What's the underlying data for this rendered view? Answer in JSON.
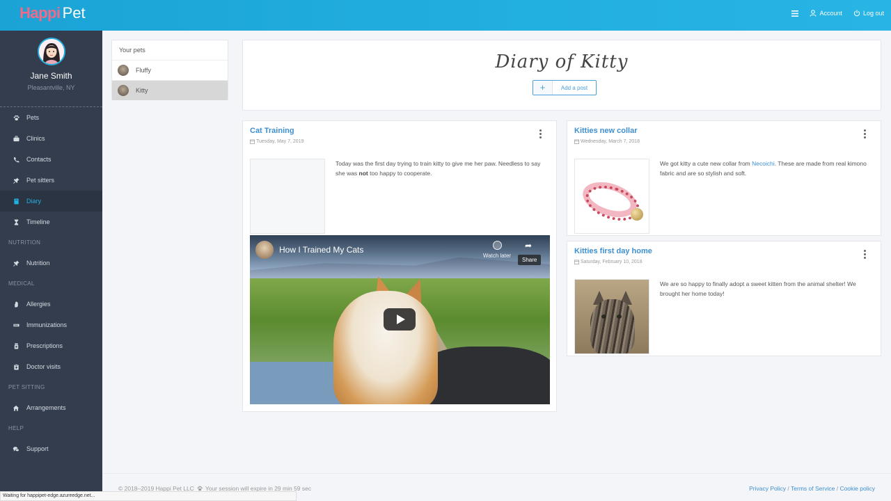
{
  "header": {
    "logo_part1": "Happi",
    "logo_part2": "Pet",
    "account_label": "Account",
    "logout_label": "Log out"
  },
  "user": {
    "name": "Jane Smith",
    "location": "Pleasantville, NY"
  },
  "sidebar": {
    "items": [
      {
        "label": "Pets",
        "icon": "paw-icon"
      },
      {
        "label": "Clinics",
        "icon": "briefcase-icon"
      },
      {
        "label": "Contacts",
        "icon": "phone-icon"
      },
      {
        "label": "Pet sitters",
        "icon": "pin-icon"
      },
      {
        "label": "Diary",
        "icon": "book-icon",
        "active": true
      },
      {
        "label": "Timeline",
        "icon": "hourglass-icon"
      }
    ],
    "sections": {
      "nutrition": {
        "title": "NUTRITION",
        "items": [
          {
            "label": "Nutrition",
            "icon": "pin-icon"
          }
        ]
      },
      "medical": {
        "title": "MEDICAL",
        "items": [
          {
            "label": "Allergies",
            "icon": "hand-icon"
          },
          {
            "label": "Immunizations",
            "icon": "syringe-icon"
          },
          {
            "label": "Prescriptions",
            "icon": "bottle-icon"
          },
          {
            "label": "Doctor visits",
            "icon": "clipboard-icon"
          }
        ]
      },
      "pet_sitting": {
        "title": "PET SITTING",
        "items": [
          {
            "label": "Arrangements",
            "icon": "home-icon"
          }
        ]
      },
      "help": {
        "title": "HELP",
        "items": [
          {
            "label": "Support",
            "icon": "chat-icon"
          }
        ]
      }
    }
  },
  "pets_panel": {
    "title": "Your pets",
    "pets": [
      {
        "name": "Fluffy",
        "selected": false
      },
      {
        "name": "Kitty",
        "selected": true
      }
    ]
  },
  "diary": {
    "title": "Diary of Kitty",
    "add_post_label": "Add a post"
  },
  "posts": [
    {
      "title": "Cat Training",
      "date": "Tuesday, May 7, 2019",
      "text_before": "Today was the first day trying to train kitty to give me her paw. Needless to say she was ",
      "text_bold": "not",
      "text_after": " too happy to cooperate.",
      "video": {
        "title": "How I Trained My Cats",
        "watch_later": "Watch later",
        "share": "Share"
      }
    },
    {
      "title": "Kitties new collar",
      "date": "Wednesday, March 7, 2018",
      "text_before": "We got kitty a cute new collar from ",
      "link": "Necoichi",
      "text_after": ". These are made from real kimono fabric and are so stylish and soft."
    },
    {
      "title": "Kitties first day home",
      "date": "Saturday, February 10, 2018",
      "text": "We are so happy to finally adopt a sweet kitten from the animal shelter! We brought her home today!"
    }
  ],
  "footer": {
    "copyright": "© 2018–2019 Happi Pet LLC",
    "session": "Your session will expire in 29 min 59 sec",
    "privacy": "Privacy Policy",
    "terms": "Terms of Service",
    "cookie": "Cookie policy",
    "separator": "/"
  },
  "status_bar": "Waiting for happipet-edge.azureedge.net...",
  "colors": {
    "header": "#22b0e0",
    "sidebar": "#333d4e",
    "link": "#3d8fd0",
    "logo_accent": "#f06a8a"
  }
}
